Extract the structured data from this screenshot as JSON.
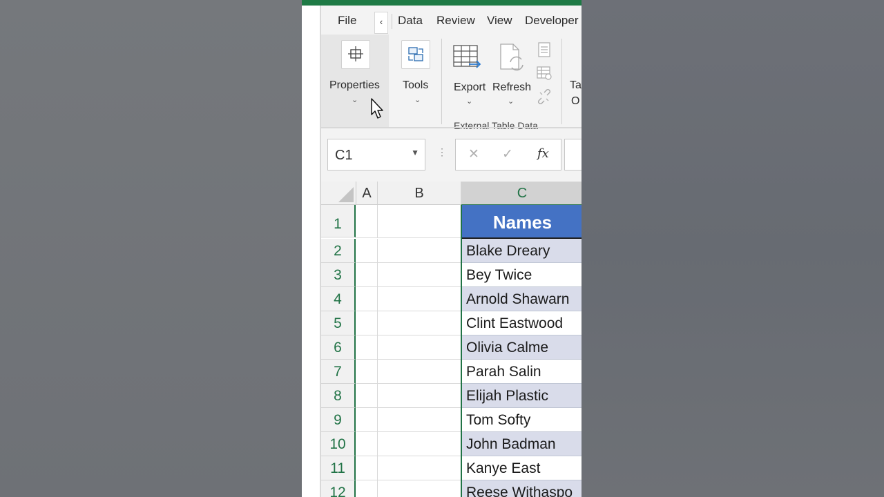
{
  "tabs": {
    "file": "File",
    "scroll_left": "‹",
    "data": "Data",
    "review": "Review",
    "view": "View",
    "developer": "Developer"
  },
  "ribbon": {
    "properties_label": "Properties",
    "tools_label": "Tools",
    "export_label": "Export",
    "refresh_label": "Refresh",
    "external_table_data_label": "External Table Data",
    "table_options_label_top": "Ta",
    "table_options_label_bottom": "O"
  },
  "formula_bar": {
    "name_box_value": "C1",
    "cancel_symbol": "✕",
    "enter_symbol": "✓",
    "fx_symbol": "fx",
    "formula_value": ""
  },
  "grid": {
    "column_headers": [
      "A",
      "B",
      "C"
    ],
    "row_numbers": [
      "1",
      "2",
      "3",
      "4",
      "5",
      "6",
      "7",
      "8",
      "9",
      "10",
      "11",
      "12"
    ],
    "header_cell": "Names",
    "names": [
      "Blake Dreary",
      "Bey Twice",
      "Arnold Shawarn",
      "Clint Eastwood",
      "Olivia Calme",
      "Parah Salin",
      "Elijah Plastic",
      "Tom Softy",
      "John Badman",
      "Kanye East",
      "Reese Withaspo"
    ]
  },
  "colors": {
    "accent_green": "#217346",
    "table_header_blue": "#4472c4",
    "banded_row": "#d9dcea"
  }
}
